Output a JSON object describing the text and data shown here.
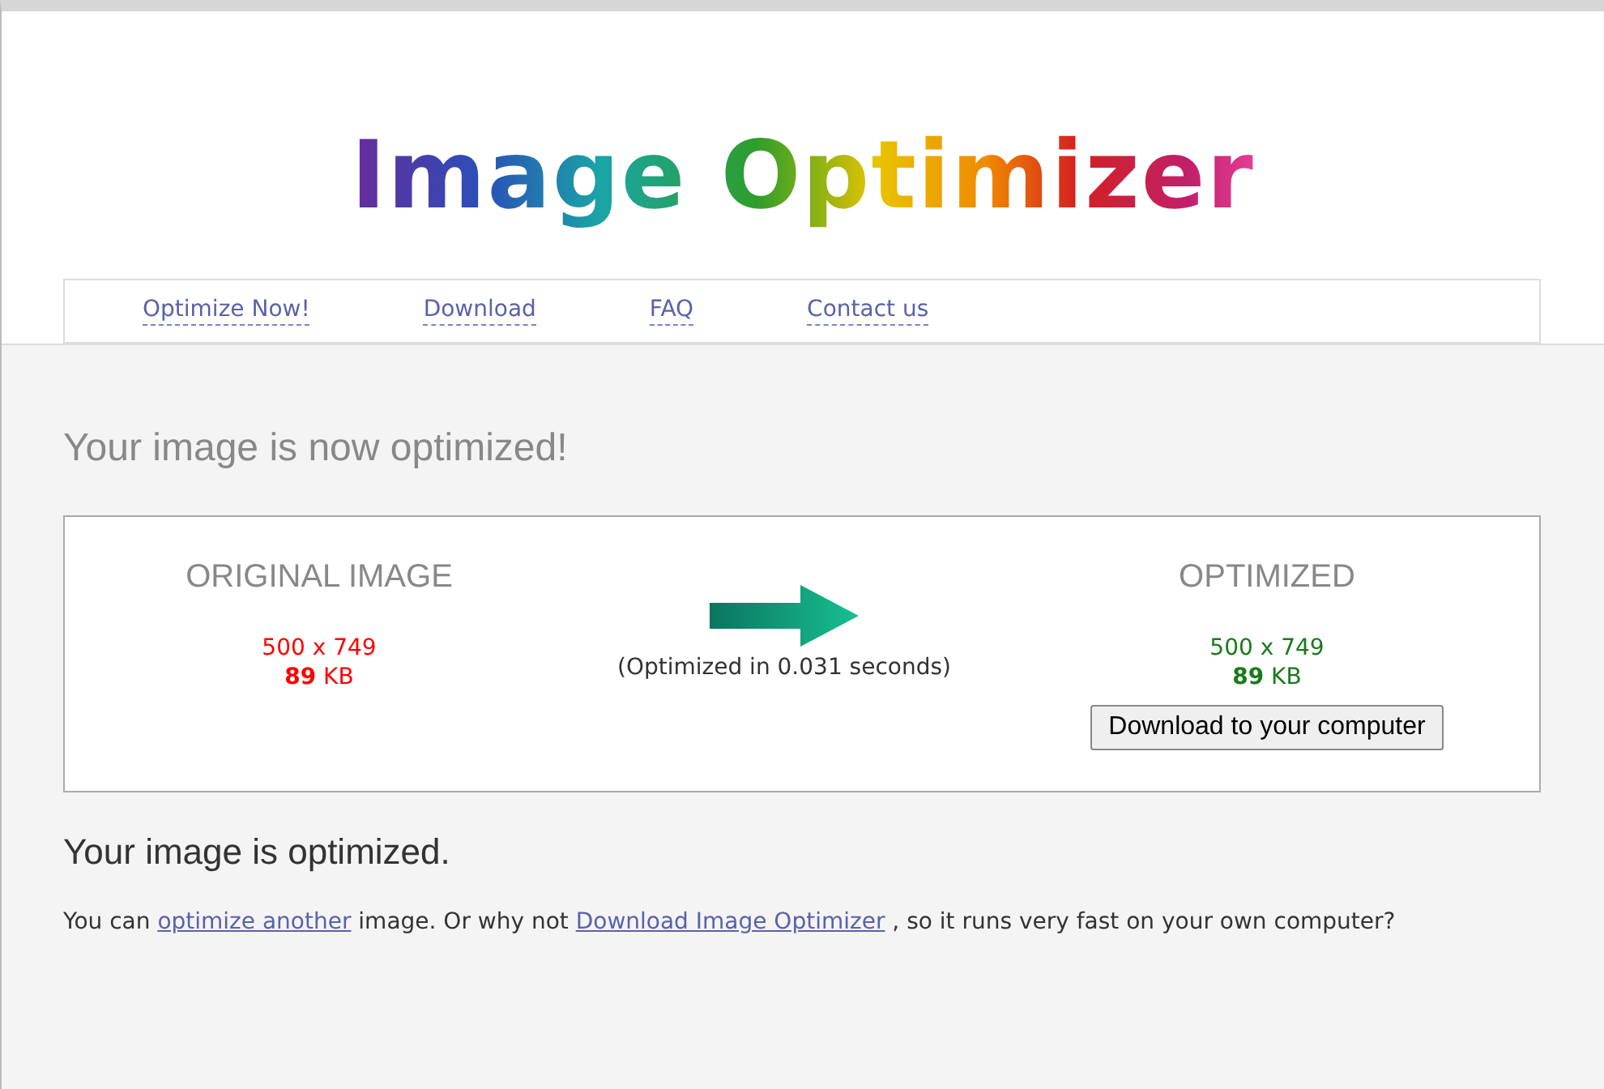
{
  "logo": {
    "text": "Image Optimizer"
  },
  "nav": [
    {
      "label": "Optimize Now!"
    },
    {
      "label": "Download"
    },
    {
      "label": "FAQ"
    },
    {
      "label": "Contact us"
    }
  ],
  "heading": "Your image is now optimized!",
  "result": {
    "original": {
      "title": "ORIGINAL IMAGE",
      "dimensions": "500 x 749",
      "size": "**89** KB"
    },
    "timing": "(Optimized in 0.031 seconds)",
    "optimized": {
      "title": "OPTIMIZED",
      "dimensions": "500 x 749",
      "size": "**89** KB"
    },
    "download_button": "Download to your computer"
  },
  "subheading": "Your image is optimized.",
  "message": [
    {
      "kind": "text",
      "text": "You can "
    },
    {
      "kind": "link",
      "text": "optimize another"
    },
    {
      "kind": "text",
      "text": " image. Or why not "
    },
    {
      "kind": "link",
      "text": "Download Image Optimizer"
    },
    {
      "kind": "text",
      "text": " , so it runs very fast on your own computer?"
    }
  ]
}
